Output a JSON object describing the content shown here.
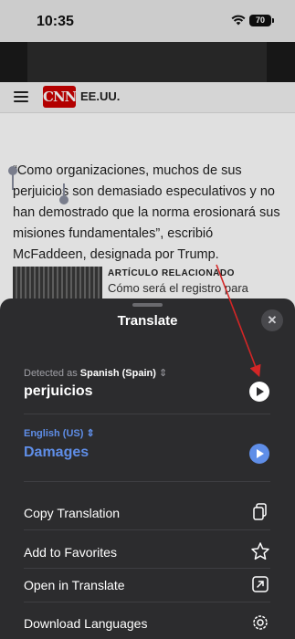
{
  "status": {
    "time": "10:35",
    "battery": "70"
  },
  "site": {
    "edition": "EE.UU.",
    "logo_text": "CNN"
  },
  "article": {
    "quote": "“Como organizaciones, muchos de sus perjuicios son demasiado especulativos y no han demostrado que la norma erosionará sus misiones fundamentales”, escribió McFaddeen, designada por Trump.",
    "related_tag": "ARTÍCULO RELACIONADO",
    "related_headline": "Cómo será el registro para"
  },
  "translate": {
    "title": "Translate",
    "detected_prefix": "Detected as",
    "detected_language": "Spanish (Spain)",
    "source_text": "perjuicios",
    "target_language": "English (US)",
    "target_text": "Damages",
    "menu": [
      {
        "label": "Copy Translation",
        "icon": "copy-icon"
      },
      {
        "label": "Add to Favorites",
        "icon": "star-icon"
      },
      {
        "label": "Open in Translate",
        "icon": "open-external-icon"
      },
      {
        "label": "Download Languages",
        "icon": "gear-icon"
      }
    ]
  },
  "colors": {
    "accent": "#5f8ee8",
    "sheet": "#2c2c2e",
    "annotation_arrow": "#d32626",
    "brand": "#cc0000"
  }
}
